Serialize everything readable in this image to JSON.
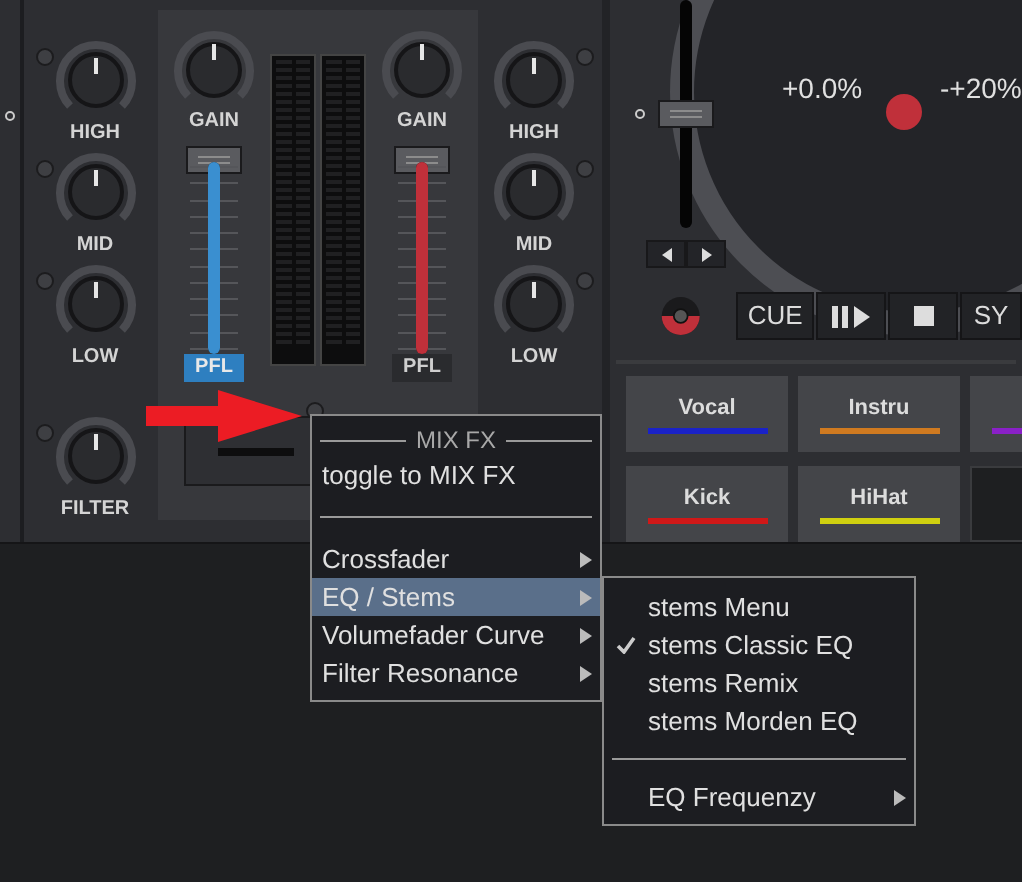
{
  "left_knobs": [
    {
      "label": "HIGH"
    },
    {
      "label": "MID"
    },
    {
      "label": "LOW"
    },
    {
      "label": "FILTER"
    }
  ],
  "mixer": {
    "channels": [
      {
        "gain_label": "GAIN",
        "color": "#3a8fd0",
        "level": 1,
        "pfl": {
          "label": "PFL",
          "selected": true
        }
      },
      {
        "gain_label": "GAIN",
        "color": "#c0303a",
        "level": 1,
        "pfl": {
          "label": "PFL",
          "selected": false
        }
      }
    ]
  },
  "right_knobs": [
    {
      "label": "HIGH"
    },
    {
      "label": "MID"
    },
    {
      "label": "LOW"
    }
  ],
  "deck": {
    "pitch": {
      "level": 0.5
    },
    "pitch_readout": "+0.0%",
    "pitch_range": "-+20%",
    "transport": [
      {
        "kind": "text",
        "label": "CUE"
      },
      {
        "kind": "play_pause"
      },
      {
        "kind": "stop"
      },
      {
        "kind": "text",
        "label": "SY"
      }
    ],
    "stem_pads": [
      {
        "kind": "stem",
        "label": "Vocal",
        "color": "#1a22c8"
      },
      {
        "kind": "stem",
        "label": "Instru",
        "color": "#d07a20"
      },
      {
        "kind": "stem_partial",
        "color": "#8a20c8"
      },
      {
        "kind": "stem",
        "label": "Kick",
        "color": "#d01818"
      },
      {
        "kind": "stem",
        "label": "HiHat",
        "color": "#d0d010"
      },
      {
        "kind": "blank"
      }
    ]
  },
  "context_menu": {
    "title": "MIX FX",
    "items": [
      {
        "kind": "action",
        "label": "toggle to MIX FX",
        "selected": false
      },
      {
        "kind": "separator",
        "selected": false
      },
      {
        "kind": "submenu",
        "label": "Crossfader",
        "selected": false
      },
      {
        "kind": "submenu",
        "label": "EQ / Stems",
        "selected": true
      },
      {
        "kind": "submenu",
        "label": "Volumefader Curve",
        "selected": false
      },
      {
        "kind": "submenu",
        "label": "Filter Resonance",
        "selected": false
      }
    ]
  },
  "submenu": {
    "items": [
      {
        "kind": "option",
        "label": "stems Menu",
        "checked": false
      },
      {
        "kind": "option",
        "label": "stems Classic EQ",
        "checked": true
      },
      {
        "kind": "option",
        "label": "stems Remix",
        "checked": false
      },
      {
        "kind": "option",
        "label": "stems Morden EQ",
        "checked": false
      },
      {
        "kind": "separator",
        "checked": false
      },
      {
        "kind": "submenu",
        "label": "EQ Frequenzy",
        "checked": false
      }
    ]
  }
}
